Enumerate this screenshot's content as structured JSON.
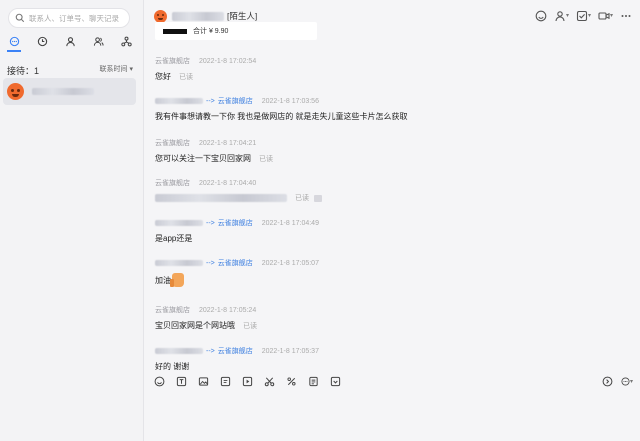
{
  "search": {
    "placeholder": "联系人、订单号、聊天记录"
  },
  "filters": [
    "chat-icon",
    "clock-icon",
    "person-icon",
    "group-icon",
    "org-icon"
  ],
  "sort": {
    "label": "接待：1",
    "option": "联系时间"
  },
  "conversation": {
    "avatar": "angry-face-avatar"
  },
  "header": {
    "title_tag": "[陌生人]"
  },
  "header_icons": [
    "smile-icon",
    "person-icon",
    "check-icon",
    "video-icon",
    "more-icon"
  ],
  "order_card": {
    "price": "合计 ¥ 9.90"
  },
  "messages": [
    {
      "sender": "云雀旗舰店",
      "time": "2022-1-8 17:02:54",
      "text": "您好",
      "read": "已读"
    },
    {
      "sender_suffix": "-->",
      "shop": "云雀旗舰店",
      "time": "2022-1-8 17:03:56",
      "text": "我有件事想请教一下你 我也是做网店的 就是走失儿童这些卡片怎么获取"
    },
    {
      "sender": "云雀旗舰店",
      "time": "2022-1-8 17:04:21",
      "text": "您可以关注一下宝贝回家网",
      "read": "已读"
    },
    {
      "sender": "云雀旗舰店",
      "time": "2022-1-8 17:04:40",
      "read": "已读"
    },
    {
      "sender_suffix": "-->",
      "shop": "云雀旗舰店",
      "time": "2022-1-8 17:04:49",
      "text": "是app还是"
    },
    {
      "sender_suffix": "-->",
      "shop": "云雀旗舰店",
      "time": "2022-1-8 17:05:07",
      "text": "加油"
    },
    {
      "sender": "云雀旗舰店",
      "time": "2022-1-8 17:05:24",
      "text": "宝贝回家网是个网站哦",
      "read": "已读"
    },
    {
      "sender_suffix": "-->",
      "shop": "云雀旗舰店",
      "time": "2022-1-8 17:05:37",
      "text": "好的 谢谢"
    }
  ],
  "toolbar": [
    "smile-icon",
    "text-icon",
    "image-icon",
    "file-icon",
    "video-icon",
    "scissors-icon",
    "percent-icon",
    "order-icon",
    "coupon-icon"
  ],
  "toolbar_right": [
    "history-icon",
    "more-icon"
  ]
}
